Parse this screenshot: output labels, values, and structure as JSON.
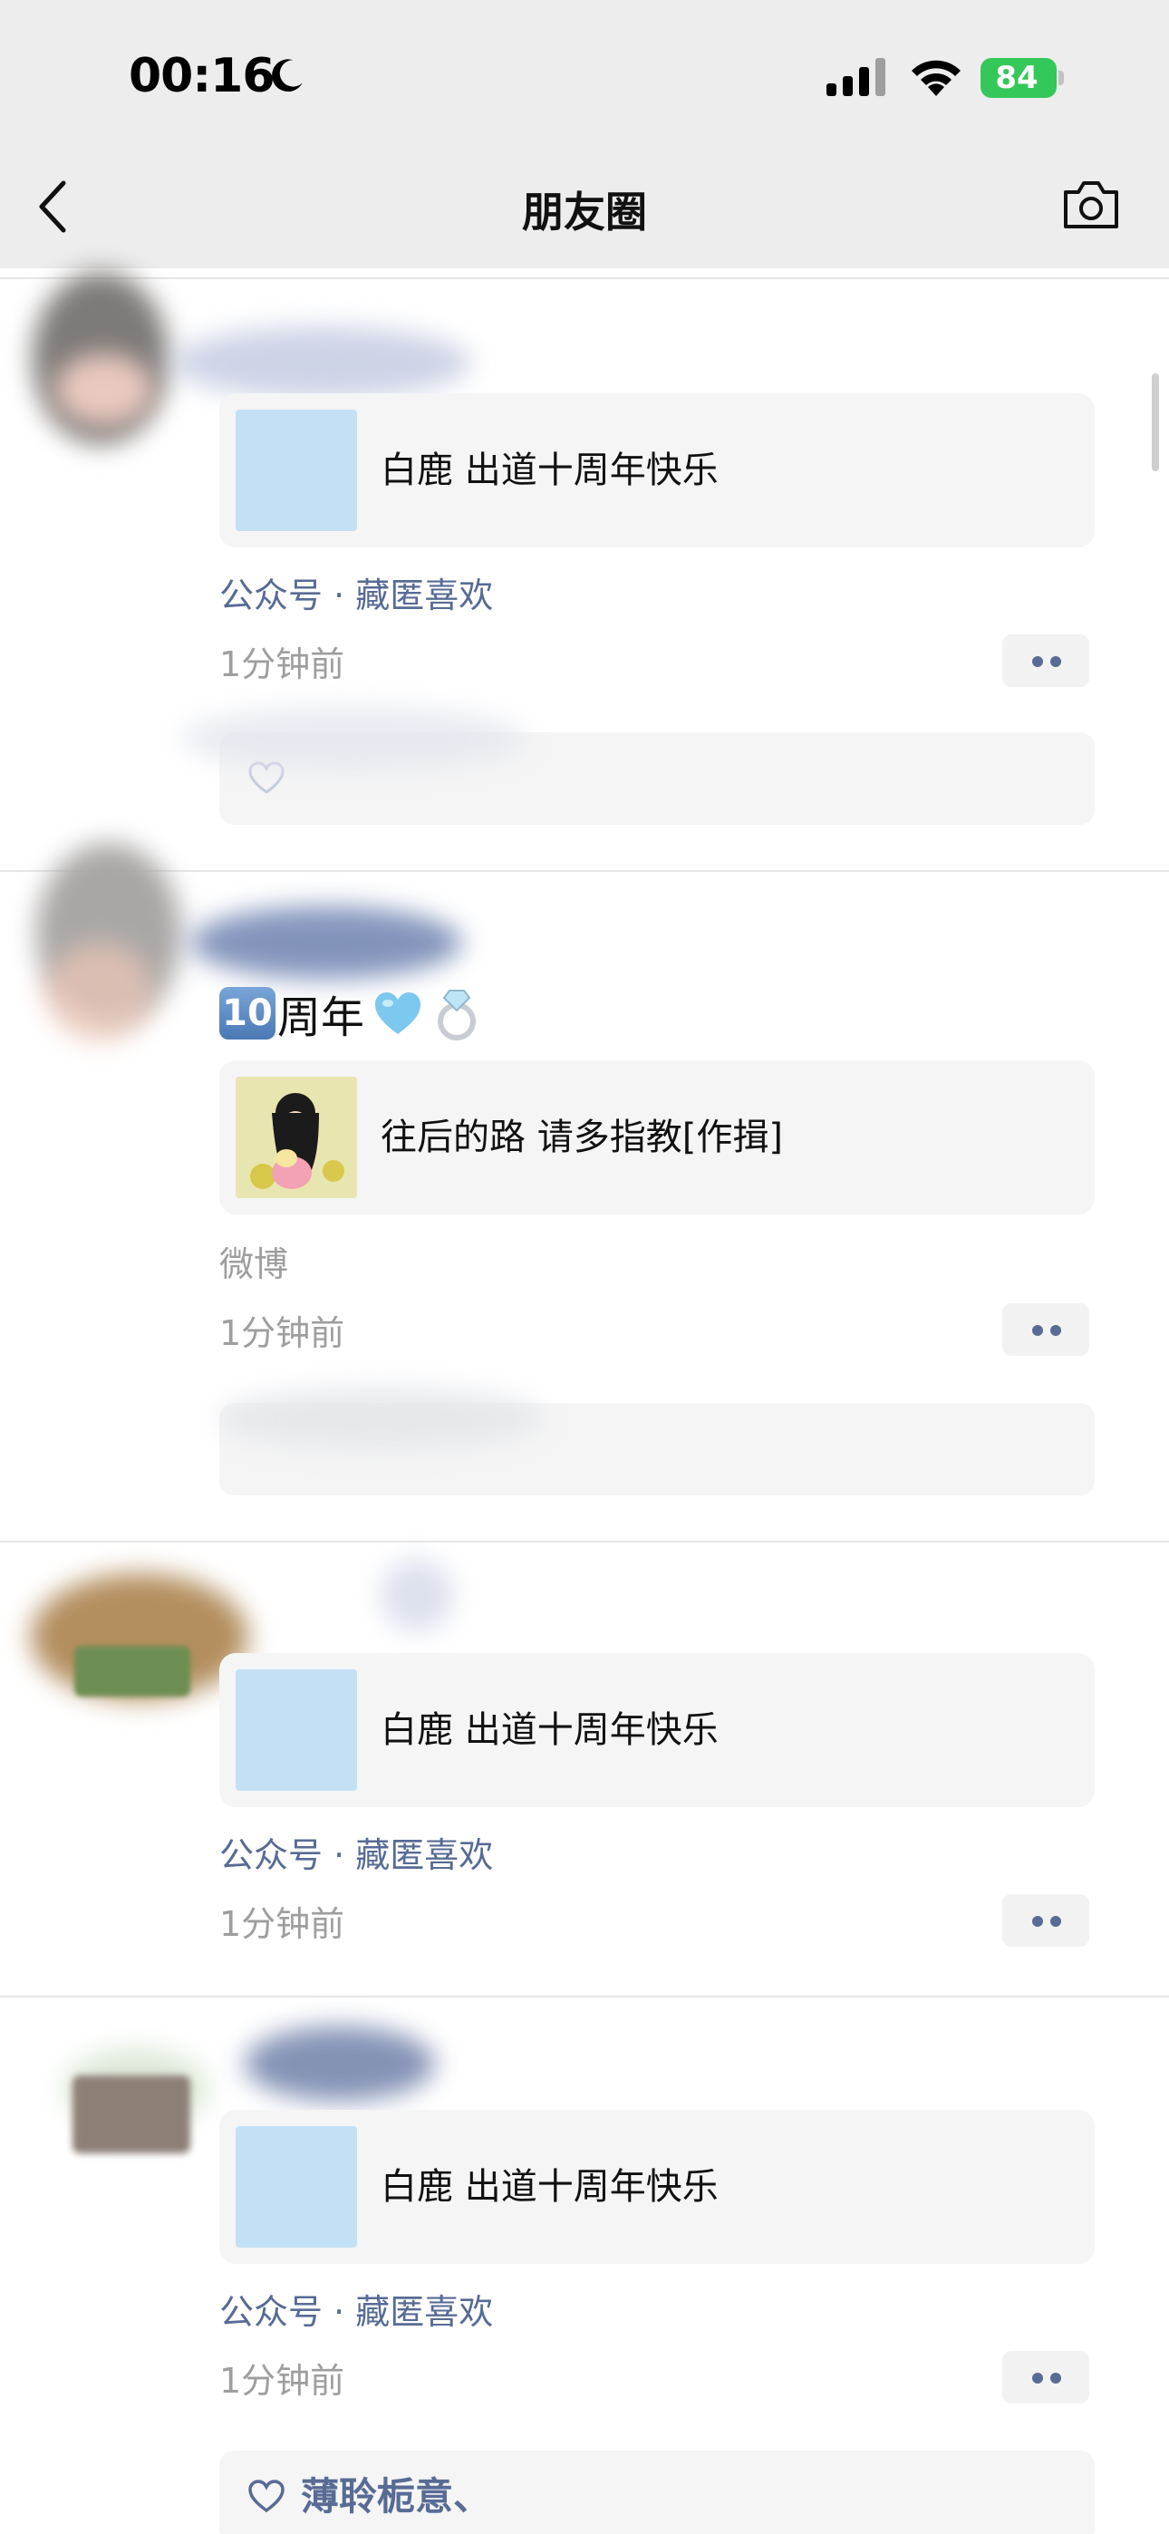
{
  "status_bar": {
    "time": "00:16",
    "battery": "84"
  },
  "header": {
    "title": "朋友圈"
  },
  "posts": [
    {
      "card_text": "白鹿  出道十周年快乐",
      "source": "公众号 · 藏匿喜欢",
      "time": "1分钟前"
    },
    {
      "text_number": "10",
      "text": "周年",
      "card_text": "往后的路 请多指教[作揖]",
      "source": "微博",
      "time": "1分钟前"
    },
    {
      "card_text": "白鹿  出道十周年快乐",
      "source": "公众号 · 藏匿喜欢",
      "time": "1分钟前"
    },
    {
      "card_text": "白鹿  出道十周年快乐",
      "source": "公众号 · 藏匿喜欢",
      "time": "1分钟前",
      "likes": "薄聆栀意、"
    }
  ],
  "colors": {
    "link": "#576b95",
    "battery": "#34c759",
    "header_bg": "#ededed"
  }
}
